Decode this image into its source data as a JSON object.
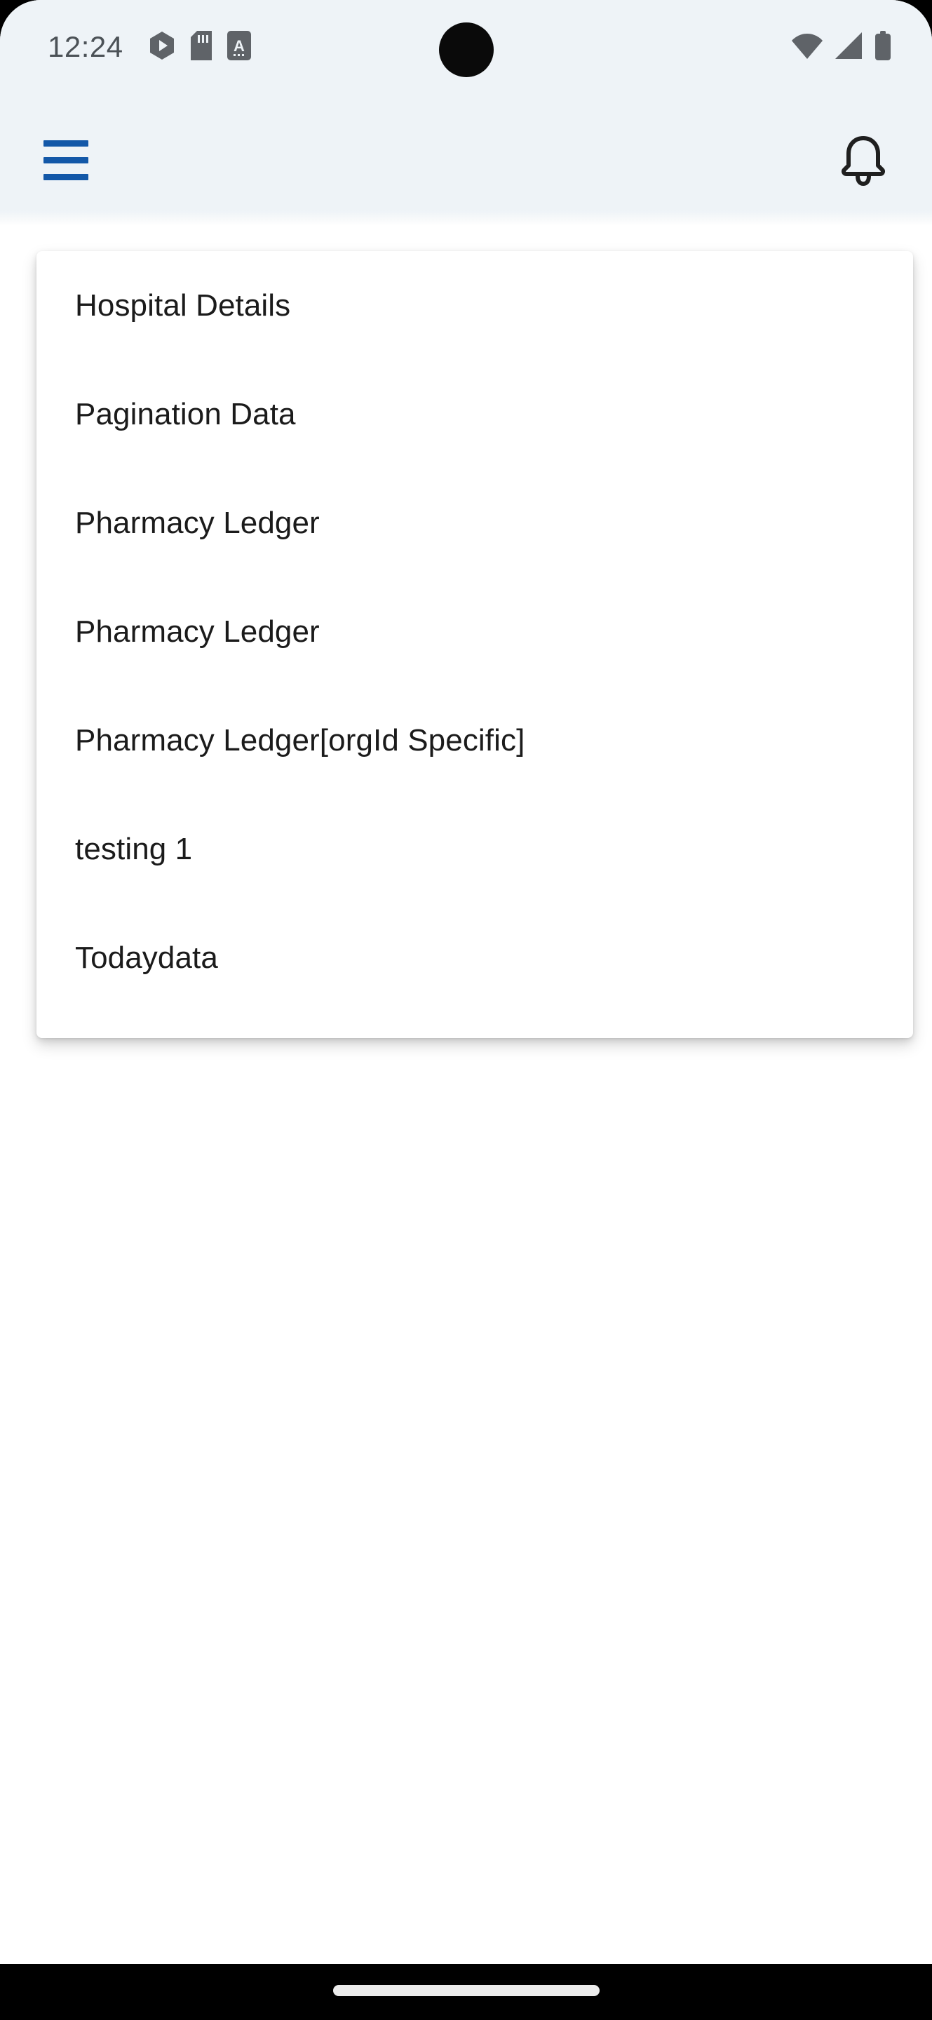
{
  "status_bar": {
    "time": "12:24",
    "left_icons": [
      "play-store-icon",
      "sd-card-icon",
      "text-a-icon"
    ],
    "right_icons": [
      "wifi-icon",
      "cellular-signal-icon",
      "battery-icon"
    ],
    "background_color": "#eef3f7",
    "text_color": "#4c5257"
  },
  "app_bar": {
    "menu_icon": "hamburger-menu-icon",
    "menu_icon_color": "#1358a8",
    "notification_icon": "notification-bell-icon",
    "notification_icon_color": "#1f1f1f",
    "background_color": "#eef3f7"
  },
  "dropdown": {
    "background_color": "#ffffff",
    "item_text_color": "#1b1b1b",
    "items": [
      {
        "label": "Hospital Details"
      },
      {
        "label": "Pagination Data"
      },
      {
        "label": "Pharmacy Ledger"
      },
      {
        "label": "Pharmacy Ledger"
      },
      {
        "label": "Pharmacy Ledger[orgId Specific]"
      },
      {
        "label": "testing 1"
      },
      {
        "label": "Todaydata"
      }
    ]
  },
  "nav_bar": {
    "gesture_pill": "home-gesture-pill",
    "background_color": "#000000"
  }
}
